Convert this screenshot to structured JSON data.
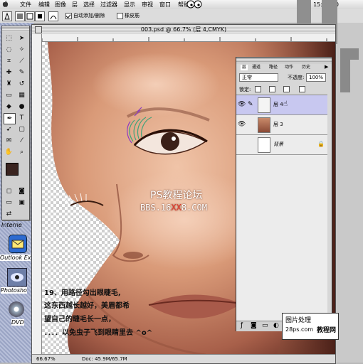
{
  "menubar": {
    "items": [
      "文件",
      "编辑",
      "图像",
      "层",
      "选择",
      "过滤器",
      "显示",
      "审视",
      "窗口",
      "帮助"
    ],
    "clock": "15:23:20"
  },
  "options_bar": {
    "auto_add_delete": "自动添加/删除",
    "rubber_band": "橡皮筋"
  },
  "document": {
    "title": "003.psd @ 66.7% (层 4,CMYK)",
    "zoom": "66.67%",
    "doc_size": "Doc: 45.9M/65.7M"
  },
  "watermark": {
    "title": "PS教程论坛",
    "url_prefix": "BBS.16",
    "url_highlight": "XX",
    "url_suffix": "8.COM"
  },
  "caption": {
    "line1": "19、用路径勾出眼睫毛,",
    "line2": "这东西越长越好，美眉都希",
    "line3": "望自己的睫毛长一点，",
    "line4": "．．．．以免虫子飞到眼睛里去 ^o^"
  },
  "layers_panel": {
    "tabs": [
      "层",
      "通道",
      "路径",
      "动作",
      "历史"
    ],
    "blend_mode": "正常",
    "opacity_label": "不透度:",
    "opacity_value": "100%",
    "lock_label": "锁定:",
    "layers": [
      {
        "name": "层 4",
        "visible": true,
        "selected": true
      },
      {
        "name": "层 3",
        "visible": true,
        "selected": false
      },
      {
        "name": "背景",
        "visible": false,
        "selected": false
      }
    ]
  },
  "desktop_icons": [
    "Interne",
    "Outlook Ex",
    "Photosho",
    "DVD"
  ],
  "logo": {
    "line1": "图片处理",
    "line2": "28ps.com",
    "badge": "教程网"
  },
  "colors": {
    "skin": "#c98a6a",
    "highlight": "#e8362a",
    "selected_layer": "#c8c8f0"
  }
}
